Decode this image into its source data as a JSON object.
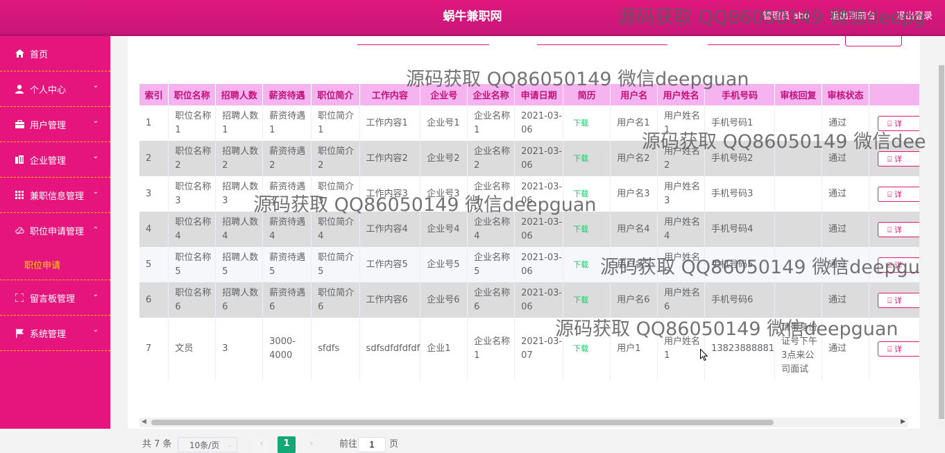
{
  "header": {
    "title": "蜗牛兼职网",
    "admin_label": "管理员 abo",
    "back_label": "退出到前台",
    "logout_label": "退出登录"
  },
  "sidebar": {
    "items": [
      {
        "label": "首页",
        "icon": "home-icon"
      },
      {
        "label": "个人中心",
        "icon": "user-icon"
      },
      {
        "label": "用户管理",
        "icon": "briefcase-icon"
      },
      {
        "label": "企业管理",
        "icon": "building-icon"
      },
      {
        "label": "兼职信息管理",
        "icon": "grid-icon"
      },
      {
        "label": "职位申请管理",
        "icon": "cloud-icon"
      },
      {
        "label": "留言板管理",
        "icon": "fullscreen-icon"
      },
      {
        "label": "系统管理",
        "icon": "flag-icon"
      }
    ],
    "subitem": "职位申请",
    "colors": {
      "bg": "#e6157e",
      "divider": "#f3c000",
      "active_sub": "#ffd400"
    }
  },
  "table": {
    "columns": [
      "索引",
      "职位名称",
      "招聘人数",
      "薪资待遇",
      "职位简介",
      "工作内容",
      "企业号",
      "企业名称",
      "申请日期",
      "简历",
      "用户名",
      "用户姓名",
      "手机号码",
      "审核回复",
      "审核状态"
    ],
    "rows": [
      [
        "1",
        "职位名称1",
        "招聘人数1",
        "薪资待遇1",
        "职位简介1",
        "工作内容1",
        "企业号1",
        "企业名称1",
        "2021-03-06",
        "下载",
        "用户名1",
        "用户姓名1",
        "手机号码1",
        "",
        "通过"
      ],
      [
        "2",
        "职位名称2",
        "招聘人数2",
        "薪资待遇2",
        "职位简介2",
        "工作内容2",
        "企业号2",
        "企业名称2",
        "2021-03-06",
        "下载",
        "用户名2",
        "用户姓名2",
        "手机号码2",
        "",
        "通过"
      ],
      [
        "3",
        "职位名称3",
        "招聘人数3",
        "薪资待遇3",
        "职位简介3",
        "工作内容3",
        "企业号3",
        "企业名称3",
        "2021-03-06",
        "下载",
        "用户名3",
        "用户姓名3",
        "手机号码3",
        "",
        "通过"
      ],
      [
        "4",
        "职位名称4",
        "招聘人数4",
        "薪资待遇4",
        "职位简介4",
        "工作内容4",
        "企业号4",
        "企业名称4",
        "2021-03-06",
        "下载",
        "用户名4",
        "用户姓名4",
        "手机号码4",
        "",
        "通过"
      ],
      [
        "5",
        "职位名称5",
        "招聘人数5",
        "薪资待遇5",
        "职位简介5",
        "工作内容5",
        "企业号5",
        "企业名称5",
        "2021-03-06",
        "下载",
        "用户名5",
        "用户姓名5",
        "手机号码5",
        "",
        "通过"
      ],
      [
        "6",
        "职位名称6",
        "招聘人数6",
        "薪资待遇6",
        "职位简介6",
        "工作内容6",
        "企业号6",
        "企业名称6",
        "2021-03-06",
        "下载",
        "用户名6",
        "用户姓名6",
        "手机号码6",
        "",
        "通过"
      ],
      [
        "7",
        "文员",
        "3",
        "3000-4000",
        "sfdfs",
        "sdfsdfdfdfdf",
        "企业1",
        "企业名称1",
        "2021-03-07",
        "下载",
        "用户1",
        "用户姓名1",
        "13823888881",
        "请带身份证号下午3点来公司面试",
        "通过"
      ]
    ],
    "action_label": "详",
    "action_icon": "document-icon"
  },
  "pagination": {
    "total_label": "共 7 条",
    "page_size": "10条/页",
    "prev": "‹",
    "current_page": "1",
    "next": "›",
    "goto_label": "前往",
    "goto_value": "1",
    "page_suffix": "页"
  },
  "watermarks": [
    "源码获取 QQ86050149 微信deepg",
    "源码获取 QQ86050149 微信deepguan",
    "源码获取 QQ86050149 微信dee",
    "源码获取 QQ86050149 微信deepguan",
    "源码获取 QQ86050149 微信deepgu",
    "源码获取 QQ86050149 微信deepguan"
  ]
}
